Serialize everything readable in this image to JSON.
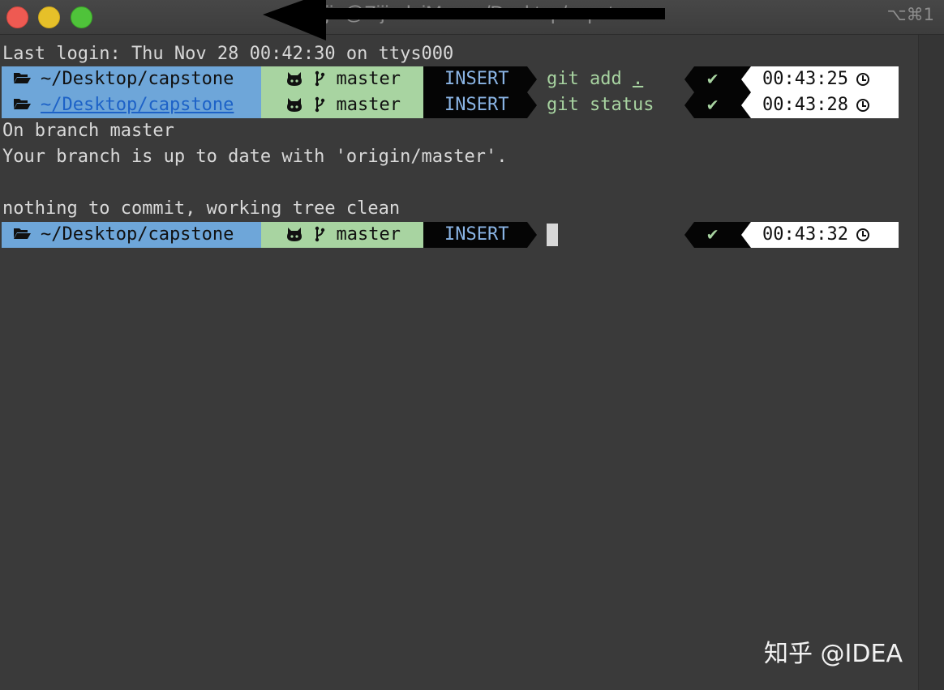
{
  "window": {
    "title": "zijia@ZijiadeiMac: ~/Desktop/capstone",
    "shortcut": "⌥⌘1"
  },
  "terminal": {
    "last_login": "Last login: Thu Nov 28 00:42:30 on ttys000",
    "prompts": [
      {
        "dir": "~/Desktop/capstone",
        "branch": "master",
        "mode": "INSERT",
        "command": "git add ",
        "command_arg": ".",
        "status": "✔",
        "time": "00:43:25"
      },
      {
        "dir": "~/Desktop/capstone",
        "branch": "master",
        "mode": "INSERT",
        "command": "git status",
        "command_arg": "",
        "status": "✔",
        "time": "00:43:28"
      },
      {
        "dir": "~/Desktop/capstone",
        "branch": "master",
        "mode": "INSERT",
        "command": "",
        "command_arg": "",
        "status": "✔",
        "time": "00:43:32"
      }
    ],
    "output": [
      "On branch master",
      "Your branch is up to date with 'origin/master'.",
      "",
      "nothing to commit, working tree clean"
    ]
  },
  "icons": {
    "folder": "folder-open-icon",
    "github": "github-icon",
    "branch": "git-branch-icon",
    "check": "check-icon",
    "clock": "clock-icon"
  },
  "colors": {
    "dir_segment": "#6ea6d9",
    "git_segment": "#a8d4a1",
    "mode_segment": "#050505",
    "mode_text": "#8ab4e4",
    "time_segment": "#ffffff",
    "link": "#1d62c7"
  },
  "watermark": "知乎 @IDEA"
}
